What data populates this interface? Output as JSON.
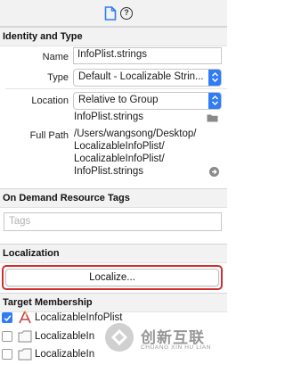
{
  "toolbar": {
    "tabs": [
      {
        "icon": "file-inspector-icon",
        "selected": true
      },
      {
        "icon": "quick-help-icon",
        "selected": false
      }
    ],
    "accent_color": "#2f7cf6",
    "help_glyph": "?"
  },
  "identity": {
    "header": "Identity and Type",
    "name_label": "Name",
    "name_value": "InfoPlist.strings",
    "type_label": "Type",
    "type_value": "Default - Localizable Strin...",
    "location_label": "Location",
    "location_value": "Relative to Group",
    "location_filename": "InfoPlist.strings",
    "fullpath_label": "Full Path",
    "fullpath_lines": [
      "/Users/wangsong/Desktop/",
      "LocalizableInfoPlist/",
      "LocalizableInfoPlist/",
      "InfoPlist.strings"
    ]
  },
  "on_demand": {
    "header": "On Demand Resource Tags",
    "tags_placeholder": "Tags"
  },
  "localization": {
    "header": "Localization",
    "button_label": "Localize...",
    "highlight_color": "#d03030"
  },
  "target_membership": {
    "header": "Target Membership",
    "targets": [
      {
        "name": "LocalizableInfoPlist",
        "checked": true,
        "icon": "app-target-icon"
      },
      {
        "name": "LocalizableIn",
        "checked": false,
        "icon": "test-target-icon"
      },
      {
        "name": "LocalizableIn",
        "checked": false,
        "icon": "test-target-icon"
      }
    ]
  },
  "watermark": {
    "title": "创新互联",
    "subtitle": "CHUANG XIN HU LIAN"
  }
}
